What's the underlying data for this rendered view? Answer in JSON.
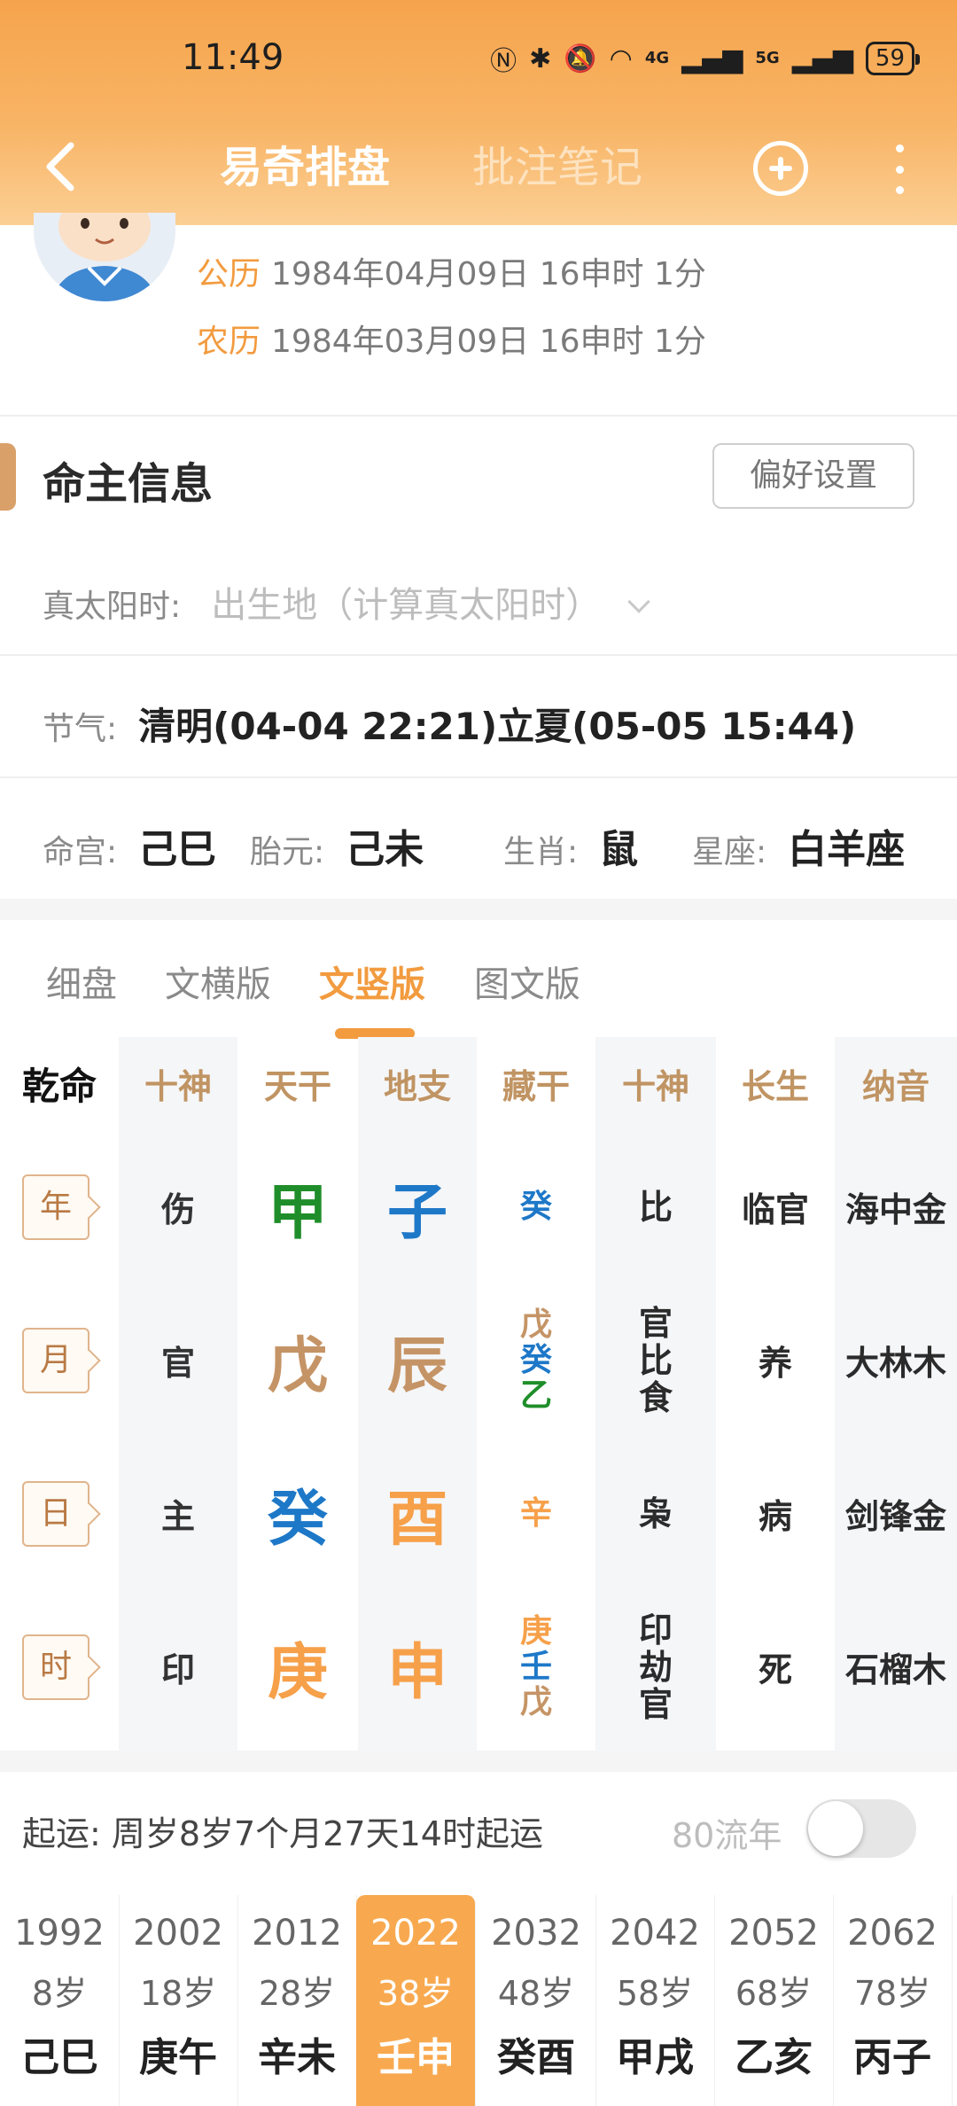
{
  "status": {
    "time": "11:49",
    "net4g": "4G",
    "net5g": "5G",
    "battery": "59"
  },
  "nav": {
    "title_active": "易奇排盘",
    "title_inactive": "批注笔记"
  },
  "profile": {
    "solar_label": "公历",
    "solar_date": "1984年04月09日 16申时 1分",
    "lunar_label": "农历",
    "lunar_date": "1984年03月09日 16申时 1分"
  },
  "owner": {
    "title": "命主信息",
    "pref_button": "偏好设置",
    "solar_time_label": "真太阳时:",
    "solar_time_placeholder": "出生地（计算真太阳时）",
    "jieqi_label": "节气:",
    "jieqi_value": "清明(04-04 22:21)立夏(05-05 15:44)",
    "minggong_label": "命宫:",
    "minggong": "己巳",
    "taiyuan_label": "胎元:",
    "taiyuan": "己未",
    "shengxiao_label": "生肖:",
    "shengxiao": "鼠",
    "xingzuo_label": "星座:",
    "xingzuo": "白羊座"
  },
  "tabs": [
    "细盘",
    "文横版",
    "文竖版",
    "图文版"
  ],
  "active_tab": 2,
  "chart": {
    "headers": [
      "乾命",
      "十神",
      "天干",
      "地支",
      "藏干",
      "十神",
      "长生",
      "纳音"
    ],
    "rows": [
      {
        "pillar": "年",
        "shishen": "伤",
        "gan": "甲",
        "gan_color": "#1f8e2a",
        "zhi": "子",
        "zhi_color": "#1e78c8",
        "canggan": [
          {
            "t": "癸",
            "c": "#1e78c8"
          }
        ],
        "shishen2": [
          "比"
        ],
        "changsheng": "临官",
        "nayin": "海中金"
      },
      {
        "pillar": "月",
        "shishen": "官",
        "gan": "戊",
        "gan_color": "#c59466",
        "zhi": "辰",
        "zhi_color": "#c59466",
        "canggan": [
          {
            "t": "戊",
            "c": "#c59466"
          },
          {
            "t": "癸",
            "c": "#1e78c8"
          },
          {
            "t": "乙",
            "c": "#1f8e2a"
          }
        ],
        "shishen2": [
          "官",
          "比",
          "食"
        ],
        "changsheng": "养",
        "nayin": "大林木"
      },
      {
        "pillar": "日",
        "shishen": "主",
        "gan": "癸",
        "gan_color": "#1e78c8",
        "zhi": "酉",
        "zhi_color": "#f6a04a",
        "canggan": [
          {
            "t": "辛",
            "c": "#f6a04a"
          }
        ],
        "shishen2": [
          "枭"
        ],
        "changsheng": "病",
        "nayin": "剑锋金"
      },
      {
        "pillar": "时",
        "shishen": "印",
        "gan": "庚",
        "gan_color": "#f6a04a",
        "zhi": "申",
        "zhi_color": "#f6a04a",
        "canggan": [
          {
            "t": "庚",
            "c": "#f6a04a"
          },
          {
            "t": "壬",
            "c": "#1e78c8"
          },
          {
            "t": "戊",
            "c": "#c59466"
          }
        ],
        "shishen2": [
          "印",
          "劫",
          "官"
        ],
        "changsheng": "死",
        "nayin": "石榴木"
      }
    ]
  },
  "luck": {
    "start_text": "起运:  周岁8岁7个月27天14时起运",
    "liunian_label": "80流年",
    "dayun": [
      {
        "year": "1992",
        "age": "8岁",
        "gz": "己巳"
      },
      {
        "year": "2002",
        "age": "18岁",
        "gz": "庚午"
      },
      {
        "year": "2012",
        "age": "28岁",
        "gz": "辛未"
      },
      {
        "year": "2022",
        "age": "38岁",
        "gz": "壬申"
      },
      {
        "year": "2032",
        "age": "48岁",
        "gz": "癸酉"
      },
      {
        "year": "2042",
        "age": "58岁",
        "gz": "甲戌"
      },
      {
        "year": "2052",
        "age": "68岁",
        "gz": "乙亥"
      },
      {
        "year": "2062",
        "age": "78岁",
        "gz": "丙子"
      }
    ],
    "selected": 3
  }
}
